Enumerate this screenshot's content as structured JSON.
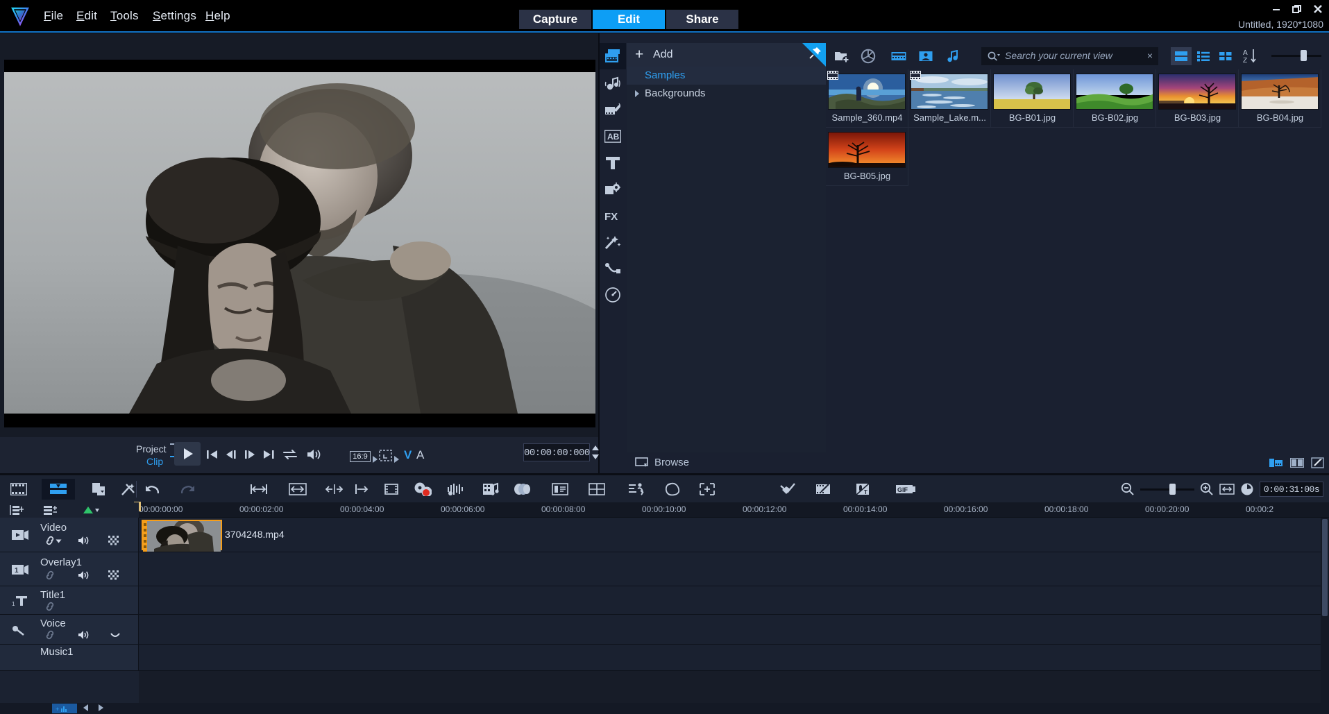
{
  "app": {
    "logo_icon": "v-logo-icon",
    "title": "Untitled, 1920*1080"
  },
  "menu": {
    "items": [
      {
        "label": "File",
        "accel": "F"
      },
      {
        "label": "Edit",
        "accel": "E"
      },
      {
        "label": "Tools",
        "accel": "T"
      },
      {
        "label": "Settings",
        "accel": "S"
      },
      {
        "label": "Help",
        "accel": "H"
      }
    ]
  },
  "modes": {
    "items": [
      {
        "label": "Capture",
        "active": false
      },
      {
        "label": "Edit",
        "active": true
      },
      {
        "label": "Share",
        "active": false
      }
    ],
    "active_color": "#0d9ef5"
  },
  "window_controls": {
    "minimize": "minimize-icon",
    "restore": "restore-icon",
    "close": "close-icon"
  },
  "preview": {
    "player_mode": {
      "project_label": "Project",
      "clip_label": "Clip",
      "selected": "Clip"
    },
    "aspect_ratio": "16:9",
    "timecode": "00:00:00:000",
    "channel_v": "V",
    "channel_a": "A",
    "transport": [
      {
        "name": "play-button",
        "glyph": "play"
      },
      {
        "name": "go-to-start-button",
        "glyph": "skip-back"
      },
      {
        "name": "previous-frame-button",
        "glyph": "step-back"
      },
      {
        "name": "next-frame-button",
        "glyph": "step-forward"
      },
      {
        "name": "go-to-end-button",
        "glyph": "skip-forward"
      },
      {
        "name": "repeat-button",
        "glyph": "loop"
      },
      {
        "name": "volume-button",
        "glyph": "speaker"
      }
    ],
    "trim_tools": [
      {
        "name": "mark-in-button",
        "label": "["
      },
      {
        "name": "mark-out-button",
        "label": "]"
      },
      {
        "name": "split-clip-button",
        "label": "scissors-icon"
      },
      {
        "name": "capture-snapshot-button",
        "label": "copy-icon"
      }
    ]
  },
  "library": {
    "rail": [
      {
        "name": "media-icon",
        "active": true
      },
      {
        "name": "audio-icon",
        "active": false
      },
      {
        "name": "transition-icon",
        "active": false
      },
      {
        "name": "ab-title-icon",
        "active": false
      },
      {
        "name": "title-icon",
        "active": false
      },
      {
        "name": "graphic-icon",
        "active": false
      },
      {
        "name": "fx-icon",
        "active": false
      },
      {
        "name": "effects-wand-icon",
        "active": false
      },
      {
        "name": "path-motion-icon",
        "active": false
      },
      {
        "name": "speed-gauge-icon",
        "active": false
      }
    ],
    "add_button": {
      "label": "Add",
      "icon": "plus-icon"
    },
    "pin_icon": "pin-icon",
    "tree": [
      {
        "label": "Samples",
        "selected": true,
        "expandable": false
      },
      {
        "label": "Backgrounds",
        "selected": false,
        "expandable": true
      }
    ],
    "browse_label": "Browse",
    "toolbar": [
      {
        "name": "add-folder-icon"
      },
      {
        "name": "camera-aperture-icon"
      },
      {
        "name": "filter-video-icon"
      },
      {
        "name": "filter-photo-icon"
      },
      {
        "name": "filter-audio-icon"
      }
    ],
    "search": {
      "placeholder": "Search your current view",
      "value": "",
      "clear_label": "×"
    },
    "view_modes": [
      {
        "name": "view-large-thumbnail",
        "active": true
      },
      {
        "name": "view-list",
        "active": false
      },
      {
        "name": "view-grid",
        "active": false
      }
    ],
    "sort_label": "A↓",
    "zoom_slider_value": 62,
    "items": [
      {
        "name": "Sample_360.mp4",
        "type": "video"
      },
      {
        "name": "Sample_Lake.m...",
        "type": "video"
      },
      {
        "name": "BG-B01.jpg",
        "type": "image"
      },
      {
        "name": "BG-B02.jpg",
        "type": "image"
      },
      {
        "name": "BG-B03.jpg",
        "type": "image"
      },
      {
        "name": "BG-B04.jpg",
        "type": "image"
      },
      {
        "name": "BG-B05.jpg",
        "type": "image"
      }
    ],
    "footer_buttons": [
      {
        "name": "library-panel-toggle",
        "active": true
      },
      {
        "name": "split-view-toggle",
        "active": false
      },
      {
        "name": "edit-toggle",
        "active": false
      }
    ]
  },
  "timeline": {
    "toolbar": [
      {
        "name": "storyboard-view-button",
        "active": false
      },
      {
        "name": "timeline-view-button",
        "active": true
      },
      {
        "name": "paste-attributes-button",
        "active": false
      },
      {
        "name": "mix-tools-button",
        "active": false
      },
      {
        "name": "undo-button",
        "active": false
      },
      {
        "name": "redo-button",
        "active": false,
        "disabled": true
      },
      {
        "name": "fit-project-button",
        "active": false
      },
      {
        "name": "ripple-edit-button",
        "active": false
      },
      {
        "name": "split-by-scene-button",
        "active": false
      },
      {
        "name": "extend-button",
        "active": false
      },
      {
        "name": "record-capture-button",
        "active": false
      },
      {
        "name": "mix-audio-button",
        "active": false
      },
      {
        "name": "audio-ducking-button",
        "active": false
      },
      {
        "name": "auto-music-button",
        "active": false
      },
      {
        "name": "subtitle-editor-button",
        "active": false
      },
      {
        "name": "multicam-editor-button",
        "active": false
      },
      {
        "name": "motion-tracking-button",
        "active": false
      },
      {
        "name": "pan-and-zoom-button",
        "active": false
      },
      {
        "name": "crop-button",
        "active": false
      },
      {
        "name": "mask-creator-button",
        "active": false
      },
      {
        "name": "video-editor-button",
        "active": false
      },
      {
        "name": "speech-to-text-button",
        "active": false
      },
      {
        "name": "gif-creator-button",
        "active": false
      }
    ],
    "track_header_tools": [
      {
        "name": "track-manager-button"
      },
      {
        "name": "add-track-button"
      },
      {
        "name": "keyframe-button"
      }
    ],
    "ruler_ticks": [
      "00:00:00:00",
      "00:00:02:00",
      "00:00:04:00",
      "00:00:06:00",
      "00:00:08:00",
      "00:00:10:00",
      "00:00:12:00",
      "00:00:14:00",
      "00:00:16:00",
      "00:00:18:00",
      "00:00:20:00",
      "00:00:2"
    ],
    "playhead_position": "00:00:00:00",
    "tracks": [
      {
        "name": "Video",
        "icon": "video-track-icon",
        "has_link": true,
        "has_mute": true,
        "has_opacity": true,
        "has_chevron": true
      },
      {
        "name": "Overlay1",
        "icon": "overlay-track-icon",
        "has_link": true,
        "has_mute": true,
        "has_opacity": true,
        "has_chevron": false
      },
      {
        "name": "Title1",
        "icon": "title-track-icon",
        "has_link": true,
        "has_mute": false,
        "has_opacity": false,
        "has_chevron": false
      },
      {
        "name": "Voice",
        "icon": "voice-track-icon",
        "has_link": true,
        "has_mute": true,
        "has_opacity": false,
        "has_chevron": true
      },
      {
        "name": "Music1",
        "icon": "music-track-icon",
        "has_link": false,
        "has_mute": false,
        "has_opacity": false,
        "has_chevron": false
      }
    ],
    "clips": [
      {
        "track": "Video",
        "name": "3704248.mp4",
        "selected": true,
        "selection_color": "#f59e1b"
      }
    ],
    "zoom": {
      "out_label": "zoom-out-icon",
      "in_label": "zoom-in-icon",
      "fit_label": "fit-icon",
      "value": 58
    },
    "duration": "0:00:31:00s"
  }
}
